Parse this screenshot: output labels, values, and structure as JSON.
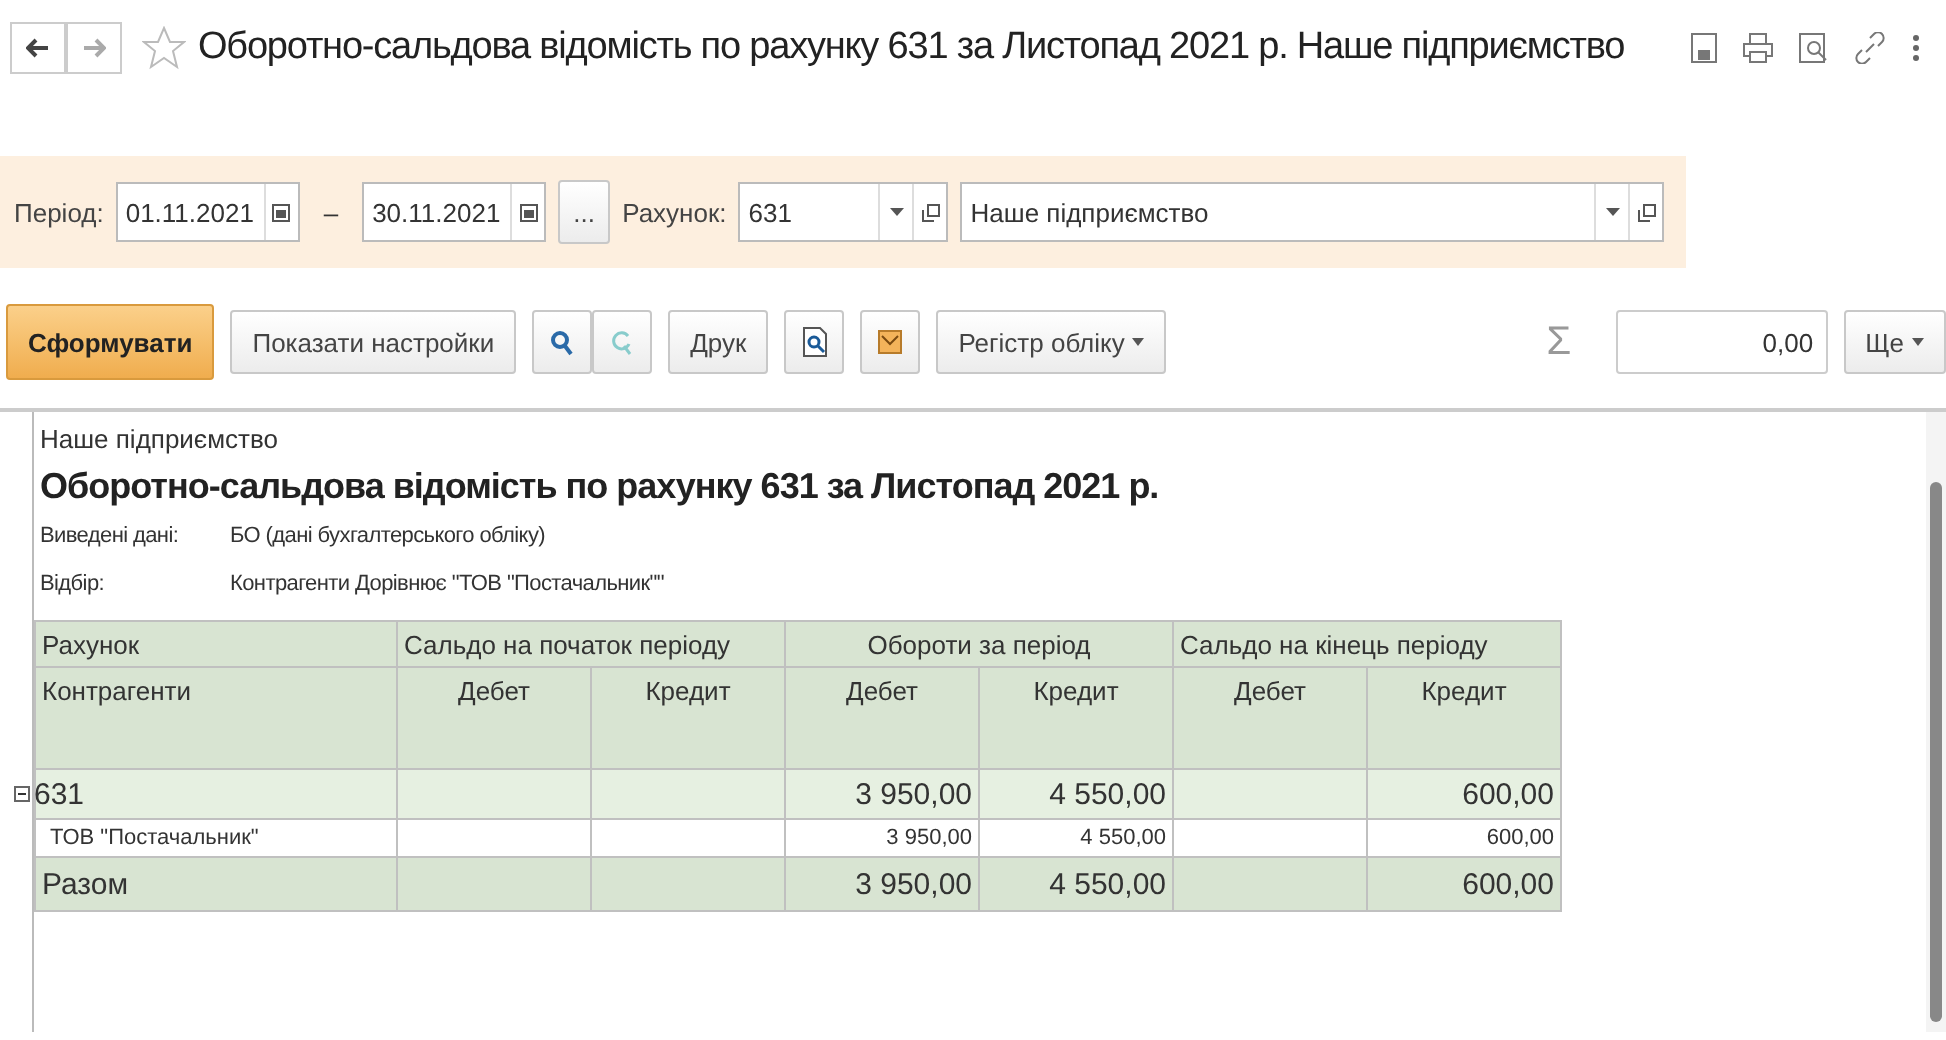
{
  "window": {
    "title": "Оборотно-сальдова відомість по рахунку 631 за Листопад 2021 р. Наше підприємство"
  },
  "filters": {
    "period_label": "Період:",
    "date_from": "01.11.2021",
    "dash": "–",
    "date_to": "30.11.2021",
    "more": "...",
    "account_label": "Рахунок:",
    "account": "631",
    "organization": "Наше підприємство"
  },
  "toolbar": {
    "generate": "Сформувати",
    "settings": "Показати настройки",
    "print": "Друк",
    "register": "Регістр обліку",
    "sum_sign": "Σ",
    "sum": "0,00",
    "more": "Ще"
  },
  "report": {
    "organization": "Наше підприємство",
    "title": "Оборотно-сальдова відомість по рахунку 631 за Листопад 2021 р.",
    "params": [
      {
        "label": "Виведені дані:",
        "value": "БО (дані бухгалтерського обліку)"
      },
      {
        "label": "Відбір:",
        "value": "Контрагенти Дорівнює \"ТОВ \"Постачальник\"\""
      }
    ],
    "header_top": [
      "Рахунок",
      "Сальдо на початок періоду",
      "Обороти за період",
      "Сальдо на кінець періоду"
    ],
    "header_sub": [
      "Контрагенти",
      "Дебет",
      "Кредит",
      "Дебет",
      "Кредит",
      "Дебет",
      "Кредит"
    ],
    "rows": [
      {
        "kind": "group",
        "expanded": true,
        "cells": [
          "631",
          "",
          "",
          "3 950,00",
          "4 550,00",
          "",
          "600,00"
        ]
      },
      {
        "kind": "detail",
        "cells": [
          "ТОВ \"Постачальник\"",
          "",
          "",
          "3 950,00",
          "4 550,00",
          "",
          "600,00"
        ]
      },
      {
        "kind": "total",
        "cells": [
          "Разом",
          "",
          "",
          "3 950,00",
          "4 550,00",
          "",
          "600,00"
        ]
      }
    ]
  }
}
